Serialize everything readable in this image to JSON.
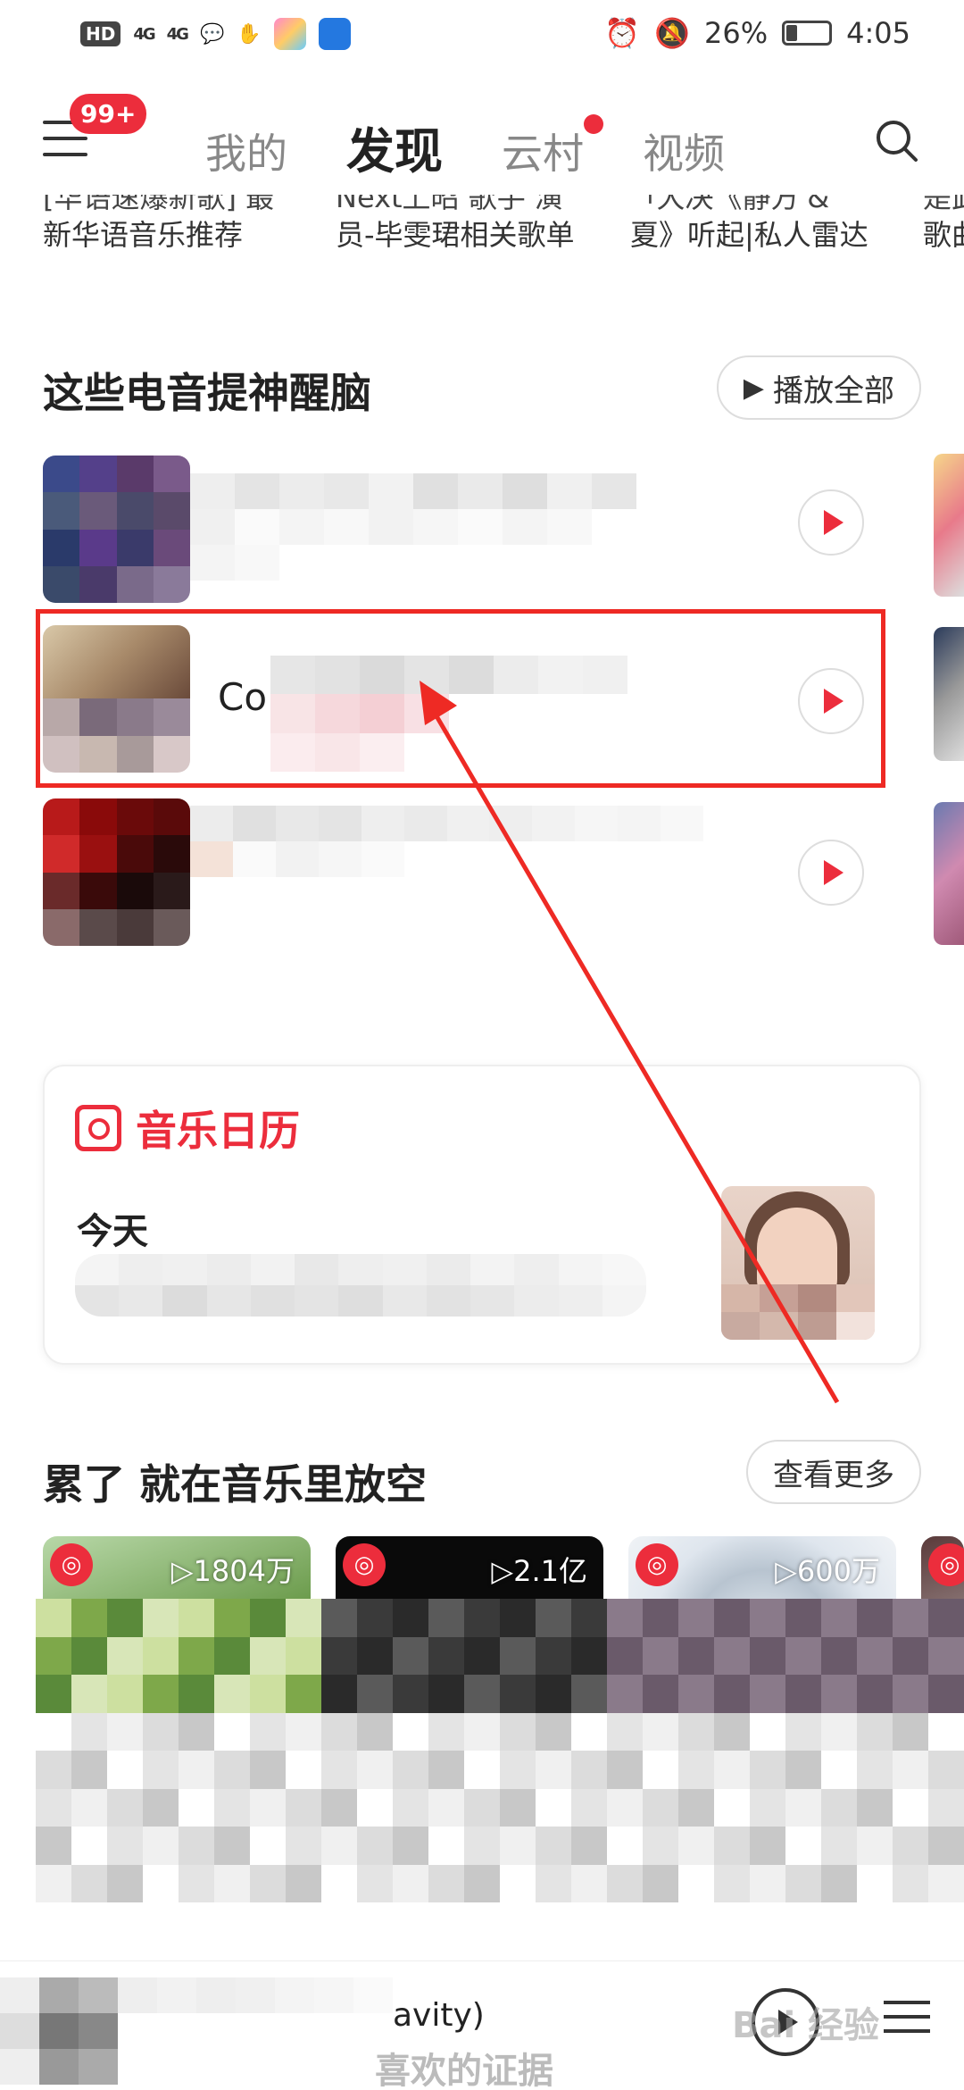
{
  "status_bar": {
    "hd": "HD",
    "sig1": "4G",
    "sig2": "4G",
    "battery": "26%",
    "battery_level": 0.26,
    "time": "4:05"
  },
  "nav": {
    "badge": "99+",
    "tabs": [
      {
        "label": "我的"
      },
      {
        "label": "发现"
      },
      {
        "label": "云村"
      },
      {
        "label": "视频"
      }
    ]
  },
  "cut_row": [
    {
      "top": "[华语速爆新歌] 最",
      "bottom": "新华语音乐推荐"
    },
    {
      "top": "Next上昭 歌手 演",
      "bottom": "员-毕雯珺相关歌单"
    },
    {
      "top": "ㄱ大决《静方'&",
      "bottom": "夏》听起|私人雷达"
    },
    {
      "top": "是此",
      "bottom": "歌曲"
    }
  ],
  "section1": {
    "title": "这些电音提神醒脑",
    "button": "播放全部"
  },
  "songs": [
    {
      "title": ""
    },
    {
      "title": "Co"
    },
    {
      "title": ""
    }
  ],
  "calendar": {
    "title": "音乐日历",
    "today": "今天"
  },
  "section2": {
    "title": "累了 就在音乐里放空",
    "button": "查看更多"
  },
  "playlists": [
    {
      "count": "▷1804万"
    },
    {
      "count": "▷2.1亿"
    },
    {
      "count": "▷600万"
    }
  ],
  "mini_player": {
    "title": "avity)",
    "subtitle": "喜欢的证据"
  },
  "watermark": "Bai 经验",
  "colors": {
    "accent": "#ec2d3c",
    "highlight": "#ee2a24"
  }
}
